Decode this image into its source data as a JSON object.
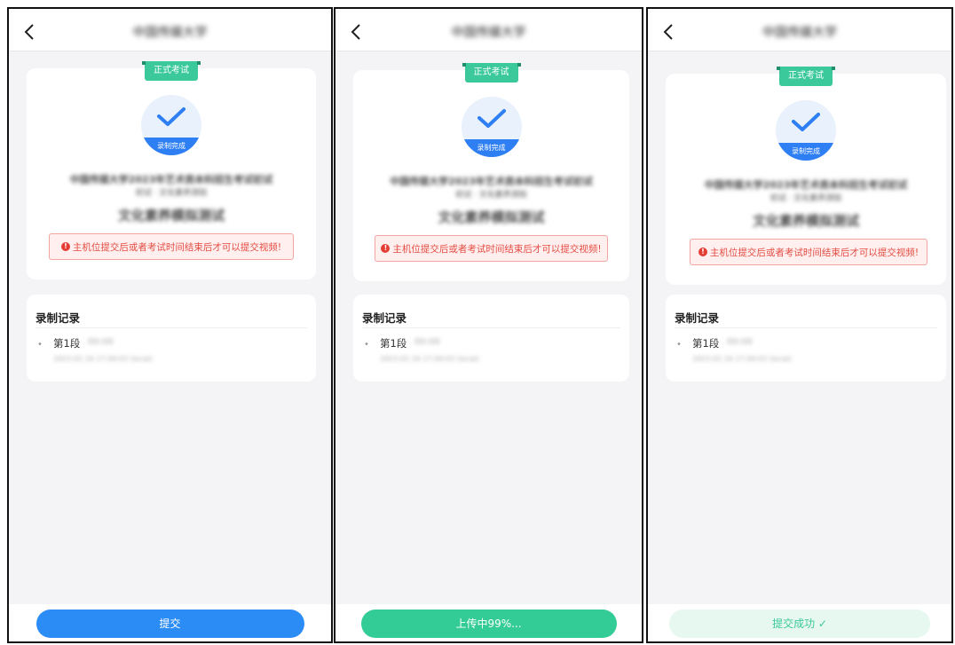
{
  "screens": [
    {
      "nav_title": "中国传媒大学",
      "badge": "正式考试",
      "status": "录制完成",
      "exam_line1": "中国传媒大学2023年艺术类本科招生考试初试",
      "exam_line2": "初试 · 文化素养测验",
      "exam_name": "文化素养模拟测试",
      "warning": "主机位提交后或者考试时间结束后才可以提交视频!",
      "records_title": "录制记录",
      "segment_label": "第1段",
      "segment_duration": "00:00",
      "segment_time": "2023.02.16 17:00:03 (local)",
      "button_label": "提交",
      "button_state": "ready",
      "colors": {
        "button_bg": "#2a8cf4",
        "button_text": "#ffffff"
      }
    },
    {
      "nav_title": "中国传媒大学",
      "badge": "正式考试",
      "status": "录制完成",
      "exam_line1": "中国传媒大学2023年艺术类本科招生考试初试",
      "exam_line2": "初试 · 文化素养测验",
      "exam_name": "文化素养模拟测试",
      "warning": "主机位提交后或者考试时间结束后才可以提交视频!",
      "records_title": "录制记录",
      "segment_label": "第1段",
      "segment_duration": "00:00",
      "segment_time": "2023.02.16 17:00:03 (local)",
      "button_label": "上传中99%...",
      "button_state": "uploading",
      "colors": {
        "button_bg": "#33cc96",
        "button_text": "#ffffff"
      }
    },
    {
      "nav_title": "中国传媒大学",
      "badge": "正式考试",
      "status": "录制完成",
      "exam_line1": "中国传媒大学2023年艺术类本科招生考试初试",
      "exam_line2": "初试 · 文化素养测验",
      "exam_name": "文化素养模拟测试",
      "warning": "主机位提交后或者考试时间结束后才可以提交视频!",
      "records_title": "录制记录",
      "segment_label": "第1段",
      "segment_duration": "00:00",
      "segment_time": "2023.02.16 17:00:03 (local)",
      "button_label": "提交成功 ✓",
      "button_state": "success",
      "colors": {
        "button_bg": "#e6f8f0",
        "button_text": "#3bc99b"
      }
    }
  ]
}
